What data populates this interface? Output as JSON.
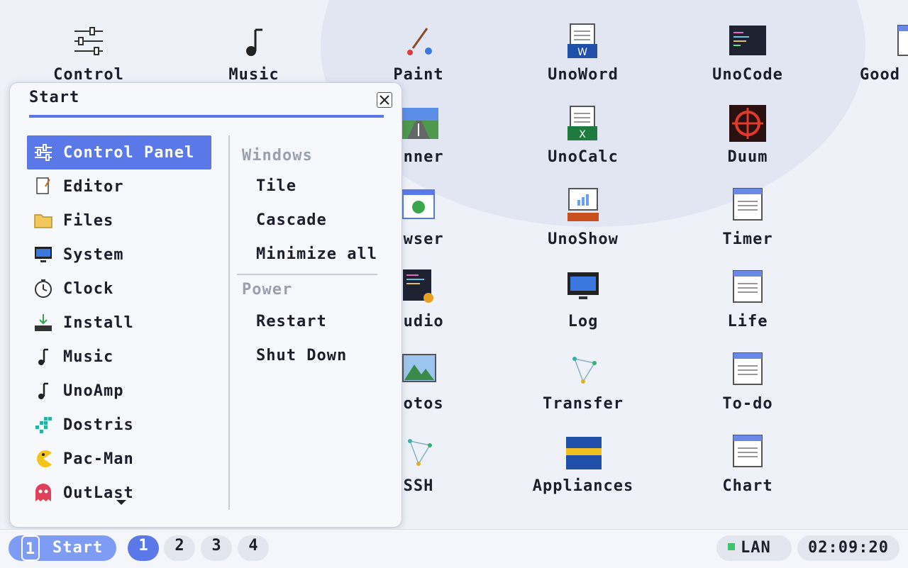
{
  "desktop": {
    "icons": [
      {
        "label": "Control",
        "icon": "control-panel-icon"
      },
      {
        "label": "Music",
        "icon": "music-note-icon"
      },
      {
        "label": "Paint",
        "icon": "paint-brush-icon"
      },
      {
        "label": "UnoWord",
        "icon": "word-document-icon"
      },
      {
        "label": "UnoCode",
        "icon": "code-editor-icon"
      },
      {
        "label": "Good",
        "icon": "window-icon"
      },
      {
        "label": "unner",
        "icon": "road-game-icon"
      },
      {
        "label": "UnoCalc",
        "icon": "spreadsheet-icon"
      },
      {
        "label": "Duum",
        "icon": "crosshair-icon"
      },
      {
        "label": "owser",
        "icon": "browser-icon"
      },
      {
        "label": "UnoShow",
        "icon": "presentation-icon"
      },
      {
        "label": "Timer",
        "icon": "window-icon"
      },
      {
        "label": "tudio",
        "icon": "code-studio-icon"
      },
      {
        "label": "Log",
        "icon": "monitor-icon"
      },
      {
        "label": "Life",
        "icon": "window-icon"
      },
      {
        "label": "hotos",
        "icon": "photo-icon"
      },
      {
        "label": "Transfer",
        "icon": "network-icon"
      },
      {
        "label": "To-do",
        "icon": "window-icon"
      },
      {
        "label": "SSH",
        "icon": "network-icon"
      },
      {
        "label": "Appliances",
        "icon": "appliances-icon"
      },
      {
        "label": "Chart",
        "icon": "window-icon"
      }
    ]
  },
  "start_menu": {
    "title": "Start",
    "apps": [
      {
        "label": "Control Panel",
        "icon": "sliders-icon",
        "selected": true
      },
      {
        "label": "Editor",
        "icon": "editor-icon"
      },
      {
        "label": "Files",
        "icon": "folder-icon"
      },
      {
        "label": "System",
        "icon": "monitor-icon"
      },
      {
        "label": "Clock",
        "icon": "clock-icon"
      },
      {
        "label": "Install",
        "icon": "download-icon"
      },
      {
        "label": "Music",
        "icon": "music-note-icon"
      },
      {
        "label": "UnoAmp",
        "icon": "music-note-icon"
      },
      {
        "label": "Dostris",
        "icon": "blocks-icon"
      },
      {
        "label": "Pac-Man",
        "icon": "pacman-icon"
      },
      {
        "label": "OutLast",
        "icon": "ghost-icon"
      }
    ],
    "windows_heading": "Windows",
    "windows_items": [
      "Tile",
      "Cascade",
      "Minimize all"
    ],
    "power_heading": "Power",
    "power_items": [
      "Restart",
      "Shut Down"
    ]
  },
  "taskbar": {
    "start_number": "1",
    "start_label": "Start",
    "workspaces": [
      "1",
      "2",
      "3",
      "4"
    ],
    "active_workspace": "1",
    "network_label": "LAN",
    "clock": "02:09:20"
  },
  "colors": {
    "accent": "#5a78e8",
    "start_button": "#7e9cf3",
    "lan_status": "#3ec46d"
  }
}
